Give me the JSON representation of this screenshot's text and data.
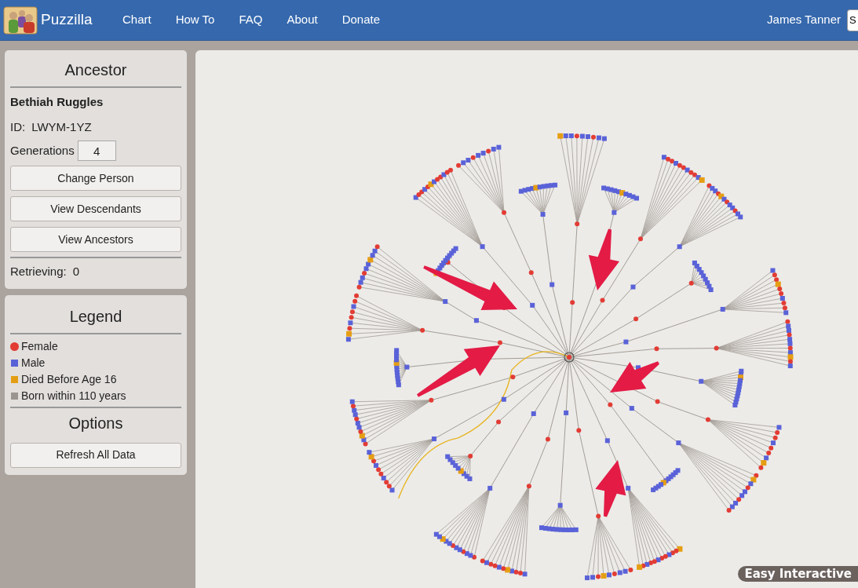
{
  "nav": {
    "logo": "Puzzilla",
    "links": [
      "Chart",
      "How To",
      "FAQ",
      "About",
      "Donate"
    ],
    "user": "James Tanner",
    "search": {
      "value": "S"
    }
  },
  "ancestor_panel": {
    "title": "Ancestor",
    "name": "Bethiah Ruggles",
    "id_label": "ID:",
    "id_value": "LWYM-1YZ",
    "generations_label": "Generations",
    "generations": "4",
    "buttons": [
      "Change Person",
      "View Descendants",
      "View Ancestors"
    ],
    "retrieving_label": "Retrieving:",
    "retrieving_value": "0"
  },
  "legend": {
    "title": "Legend",
    "items": [
      {
        "label": "Female",
        "kind": "circle",
        "color": "#e23c34"
      },
      {
        "label": "Male",
        "kind": "square",
        "color": "#5a62d8"
      },
      {
        "label": "Died Before Age 16",
        "kind": "square",
        "color": "#e59e13"
      },
      {
        "label": "Born within 110 years",
        "kind": "square",
        "color": "#9b9590"
      }
    ]
  },
  "options": {
    "title": "Options",
    "buttons": [
      "Refresh All Data"
    ]
  },
  "tooltip": "Easy Interactive"
}
